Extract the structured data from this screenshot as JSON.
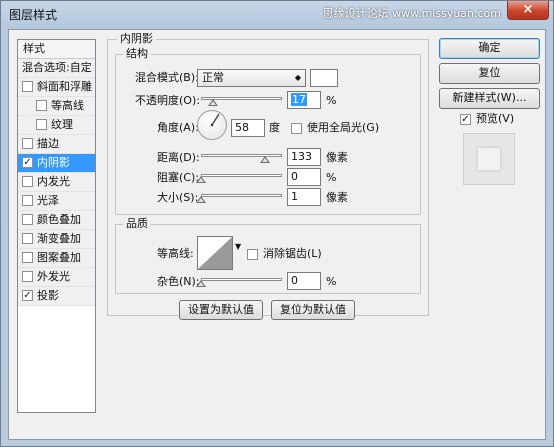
{
  "window": {
    "title": "图层样式",
    "close_label": "×",
    "watermark": "思缘设计论坛 www.missyuan.com"
  },
  "sidebar": {
    "header": "样式",
    "blend_options": "混合选项:自定",
    "items": [
      {
        "label": "斜面和浮雕",
        "checked": false
      },
      {
        "label": "等高线",
        "checked": false
      },
      {
        "label": "纹理",
        "checked": false
      },
      {
        "label": "描边",
        "checked": false
      },
      {
        "label": "内阴影",
        "checked": true
      },
      {
        "label": "内发光",
        "checked": false
      },
      {
        "label": "光泽",
        "checked": false
      },
      {
        "label": "颜色叠加",
        "checked": false
      },
      {
        "label": "渐变叠加",
        "checked": false
      },
      {
        "label": "图案叠加",
        "checked": false
      },
      {
        "label": "外发光",
        "checked": false
      },
      {
        "label": "投影",
        "checked": true
      }
    ]
  },
  "inner_shadow": {
    "group_title": "内阴影",
    "structure": {
      "title": "结构",
      "blend_mode_label": "混合模式(B):",
      "blend_mode_value": "正常",
      "opacity_label": "不透明度(O):",
      "opacity_value": "17",
      "opacity_unit": "%",
      "opacity_level": 0.17,
      "angle_label": "角度(A):",
      "angle_value": "58",
      "angle_unit": "度",
      "global_light_label": "使用全局光(G)",
      "global_light_checked": false,
      "distance_label": "距离(D):",
      "distance_value": "133",
      "distance_unit": "像素",
      "distance_level": 0.54,
      "choke_label": "阻塞(C):",
      "choke_value": "0",
      "choke_unit": "%",
      "choke_level": 0,
      "size_label": "大小(S):",
      "size_value": "1",
      "size_unit": "像素",
      "size_level": 0
    },
    "quality": {
      "title": "品质",
      "contour_label": "等高线:",
      "antialias_label": "消除锯齿(L)",
      "antialias_checked": false,
      "noise_label": "杂色(N):",
      "noise_value": "0",
      "noise_unit": "%",
      "noise_level": 0
    },
    "make_default_label": "设置为默认值",
    "reset_default_label": "复位为默认值"
  },
  "buttons": {
    "ok": "确定",
    "reset": "复位",
    "new_style": "新建样式(W)...",
    "preview_label": "预览(V)",
    "preview_checked": true
  }
}
